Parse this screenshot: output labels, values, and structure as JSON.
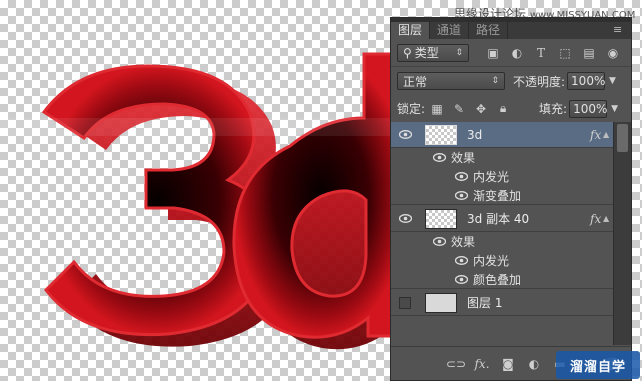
{
  "watermark": {
    "top": "思缘设计论坛",
    "top_url": "www.MISSYUAN.COM",
    "bottom": "溜溜自学"
  },
  "artwork": {
    "text": "3d",
    "colors": {
      "main": "#c10f17",
      "dark": "#130000",
      "highlight": "#f05055"
    }
  },
  "panel": {
    "tabs": [
      {
        "label": "图层"
      },
      {
        "label": "通道"
      },
      {
        "label": "路径"
      }
    ],
    "menu_icon": "panel-menu-icon",
    "filter": {
      "label": "类型"
    },
    "blend_mode": "正常",
    "opacity_label": "不透明度:",
    "opacity_value": "100%",
    "lock_label": "锁定:",
    "fill_label": "填充:",
    "fill_value": "100%",
    "layers": [
      {
        "name": "3d",
        "selected": true,
        "fx": "fx",
        "effects_label": "效果",
        "effects": [
          "内发光",
          "渐变叠加"
        ]
      },
      {
        "name": "3d 副本 40",
        "selected": false,
        "fx": "fx",
        "effects_label": "效果",
        "effects": [
          "内发光",
          "颜色叠加"
        ]
      },
      {
        "name": "图层 1",
        "selected": false
      }
    ],
    "footer_icons": [
      "link-icon",
      "fx-icon",
      "mask-icon",
      "adjustment-icon",
      "folder-icon",
      "new-layer-icon",
      "trash-icon"
    ]
  },
  "colors": {
    "panel_bg": "#535353",
    "selected_layer": "#5a6c84"
  }
}
